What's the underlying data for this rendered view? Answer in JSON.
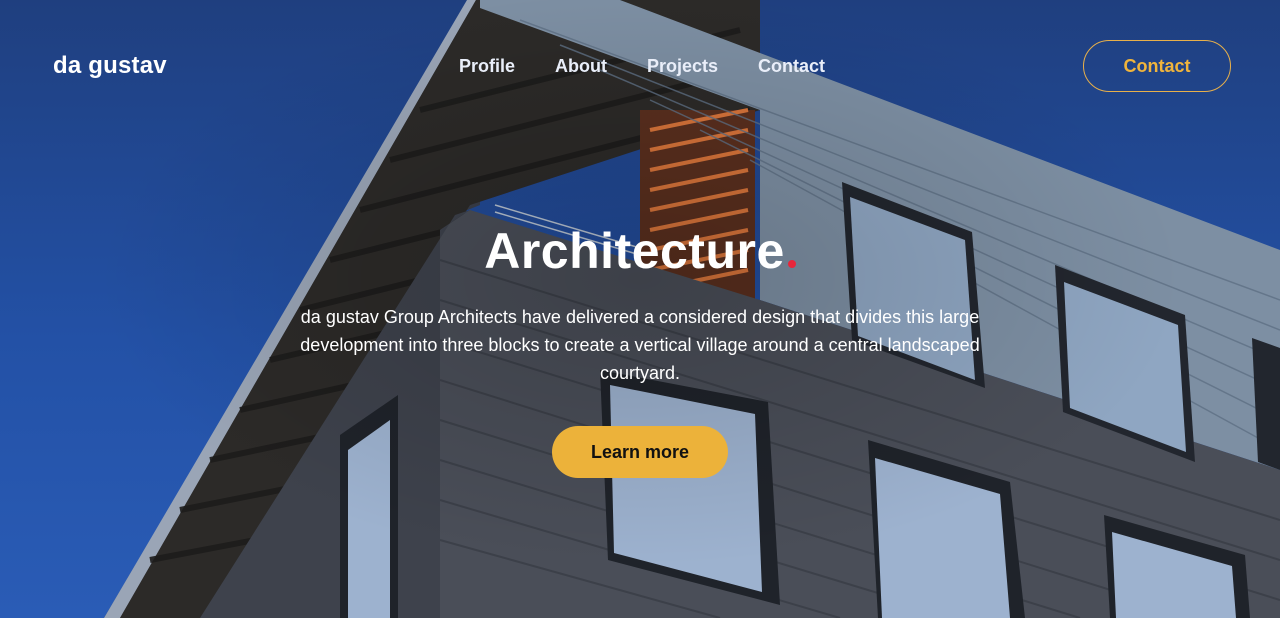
{
  "brand": {
    "logo_text": "da gustav"
  },
  "nav": {
    "items": [
      {
        "label": "Profile"
      },
      {
        "label": "About"
      },
      {
        "label": "Projects"
      },
      {
        "label": "Contact"
      }
    ]
  },
  "header": {
    "contact_button_label": "Contact"
  },
  "hero": {
    "title": "Architecture",
    "description": "da gustav Group Architects have delivered a considered design that divides this large development into three blocks to create a vertical village around a central landscaped courtyard.",
    "cta_label": "Learn more"
  },
  "colors": {
    "accent": "#ECB23A",
    "title_dot": "#E8263B",
    "sky": "#2351A6"
  }
}
